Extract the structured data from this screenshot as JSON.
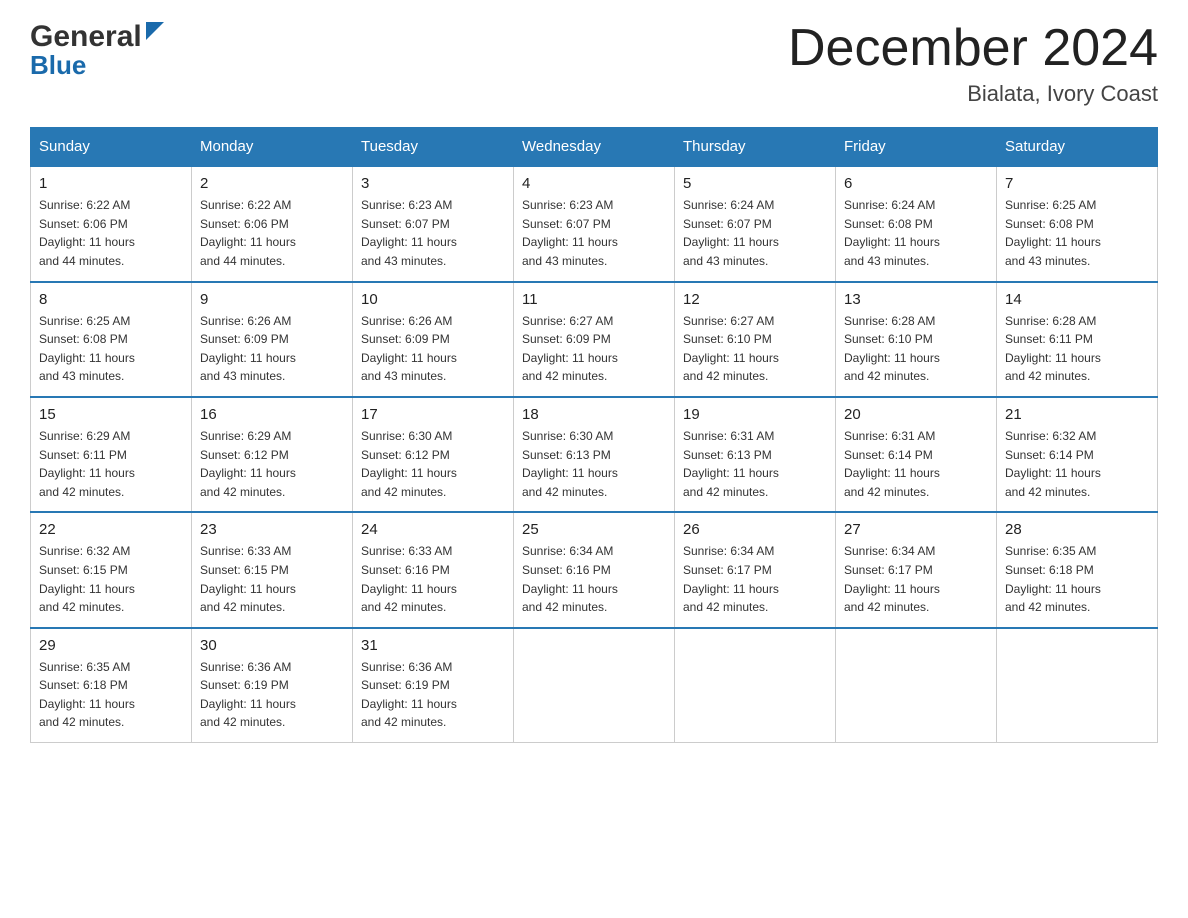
{
  "header": {
    "logo": {
      "general": "General",
      "blue": "Blue"
    },
    "title": "December 2024",
    "location": "Bialata, Ivory Coast"
  },
  "days_of_week": [
    "Sunday",
    "Monday",
    "Tuesday",
    "Wednesday",
    "Thursday",
    "Friday",
    "Saturday"
  ],
  "weeks": [
    [
      {
        "day": "1",
        "sunrise": "6:22 AM",
        "sunset": "6:06 PM",
        "daylight": "11 hours and 44 minutes."
      },
      {
        "day": "2",
        "sunrise": "6:22 AM",
        "sunset": "6:06 PM",
        "daylight": "11 hours and 44 minutes."
      },
      {
        "day": "3",
        "sunrise": "6:23 AM",
        "sunset": "6:07 PM",
        "daylight": "11 hours and 43 minutes."
      },
      {
        "day": "4",
        "sunrise": "6:23 AM",
        "sunset": "6:07 PM",
        "daylight": "11 hours and 43 minutes."
      },
      {
        "day": "5",
        "sunrise": "6:24 AM",
        "sunset": "6:07 PM",
        "daylight": "11 hours and 43 minutes."
      },
      {
        "day": "6",
        "sunrise": "6:24 AM",
        "sunset": "6:08 PM",
        "daylight": "11 hours and 43 minutes."
      },
      {
        "day": "7",
        "sunrise": "6:25 AM",
        "sunset": "6:08 PM",
        "daylight": "11 hours and 43 minutes."
      }
    ],
    [
      {
        "day": "8",
        "sunrise": "6:25 AM",
        "sunset": "6:08 PM",
        "daylight": "11 hours and 43 minutes."
      },
      {
        "day": "9",
        "sunrise": "6:26 AM",
        "sunset": "6:09 PM",
        "daylight": "11 hours and 43 minutes."
      },
      {
        "day": "10",
        "sunrise": "6:26 AM",
        "sunset": "6:09 PM",
        "daylight": "11 hours and 43 minutes."
      },
      {
        "day": "11",
        "sunrise": "6:27 AM",
        "sunset": "6:09 PM",
        "daylight": "11 hours and 42 minutes."
      },
      {
        "day": "12",
        "sunrise": "6:27 AM",
        "sunset": "6:10 PM",
        "daylight": "11 hours and 42 minutes."
      },
      {
        "day": "13",
        "sunrise": "6:28 AM",
        "sunset": "6:10 PM",
        "daylight": "11 hours and 42 minutes."
      },
      {
        "day": "14",
        "sunrise": "6:28 AM",
        "sunset": "6:11 PM",
        "daylight": "11 hours and 42 minutes."
      }
    ],
    [
      {
        "day": "15",
        "sunrise": "6:29 AM",
        "sunset": "6:11 PM",
        "daylight": "11 hours and 42 minutes."
      },
      {
        "day": "16",
        "sunrise": "6:29 AM",
        "sunset": "6:12 PM",
        "daylight": "11 hours and 42 minutes."
      },
      {
        "day": "17",
        "sunrise": "6:30 AM",
        "sunset": "6:12 PM",
        "daylight": "11 hours and 42 minutes."
      },
      {
        "day": "18",
        "sunrise": "6:30 AM",
        "sunset": "6:13 PM",
        "daylight": "11 hours and 42 minutes."
      },
      {
        "day": "19",
        "sunrise": "6:31 AM",
        "sunset": "6:13 PM",
        "daylight": "11 hours and 42 minutes."
      },
      {
        "day": "20",
        "sunrise": "6:31 AM",
        "sunset": "6:14 PM",
        "daylight": "11 hours and 42 minutes."
      },
      {
        "day": "21",
        "sunrise": "6:32 AM",
        "sunset": "6:14 PM",
        "daylight": "11 hours and 42 minutes."
      }
    ],
    [
      {
        "day": "22",
        "sunrise": "6:32 AM",
        "sunset": "6:15 PM",
        "daylight": "11 hours and 42 minutes."
      },
      {
        "day": "23",
        "sunrise": "6:33 AM",
        "sunset": "6:15 PM",
        "daylight": "11 hours and 42 minutes."
      },
      {
        "day": "24",
        "sunrise": "6:33 AM",
        "sunset": "6:16 PM",
        "daylight": "11 hours and 42 minutes."
      },
      {
        "day": "25",
        "sunrise": "6:34 AM",
        "sunset": "6:16 PM",
        "daylight": "11 hours and 42 minutes."
      },
      {
        "day": "26",
        "sunrise": "6:34 AM",
        "sunset": "6:17 PM",
        "daylight": "11 hours and 42 minutes."
      },
      {
        "day": "27",
        "sunrise": "6:34 AM",
        "sunset": "6:17 PM",
        "daylight": "11 hours and 42 minutes."
      },
      {
        "day": "28",
        "sunrise": "6:35 AM",
        "sunset": "6:18 PM",
        "daylight": "11 hours and 42 minutes."
      }
    ],
    [
      {
        "day": "29",
        "sunrise": "6:35 AM",
        "sunset": "6:18 PM",
        "daylight": "11 hours and 42 minutes."
      },
      {
        "day": "30",
        "sunrise": "6:36 AM",
        "sunset": "6:19 PM",
        "daylight": "11 hours and 42 minutes."
      },
      {
        "day": "31",
        "sunrise": "6:36 AM",
        "sunset": "6:19 PM",
        "daylight": "11 hours and 42 minutes."
      },
      null,
      null,
      null,
      null
    ]
  ],
  "labels": {
    "sunrise": "Sunrise:",
    "sunset": "Sunset:",
    "daylight": "Daylight:"
  }
}
